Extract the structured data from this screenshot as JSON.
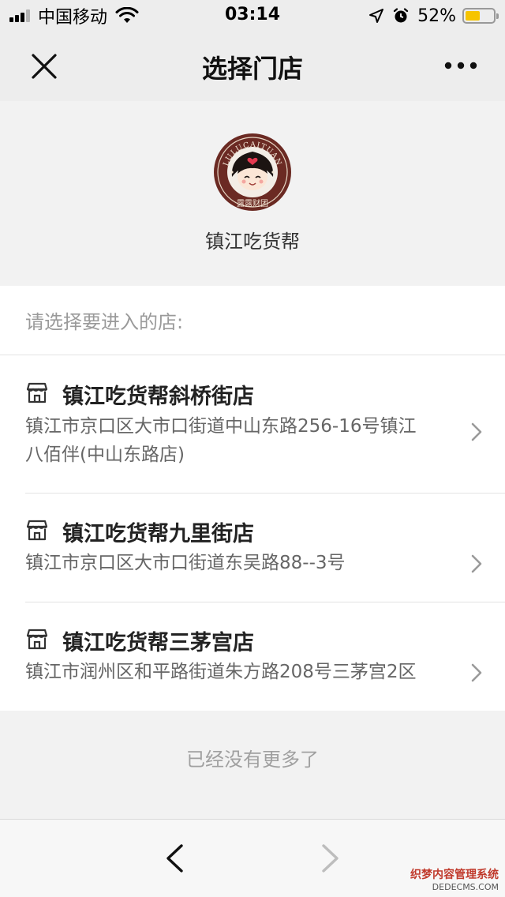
{
  "status_bar": {
    "carrier": "中国移动",
    "time": "03:14",
    "battery_percent": "52%",
    "battery_level": 0.52
  },
  "nav": {
    "title": "选择门店",
    "close_icon": "close-icon",
    "more_icon": "more-icon"
  },
  "brand": {
    "name": "镇江吃货帮",
    "logo_ring_text": "LULUCAITUAN",
    "logo_bottom_text": "露露财团"
  },
  "list": {
    "prompt": "请选择要进入的店:",
    "stores": [
      {
        "name": "镇江吃货帮斜桥街店",
        "address_line1": "镇江市京口区大市口街道中山东路256-16号镇江",
        "address_line2": "八佰伴(中山东路店)"
      },
      {
        "name": "镇江吃货帮九里街店",
        "address_line1": "镇江市京口区大市口街道东吴路88--3号"
      },
      {
        "name": "镇江吃货帮三茅宫店",
        "address_line1": "镇江市润州区和平路街道朱方路208号三茅宫2区"
      }
    ]
  },
  "end_notice": "已经没有更多了",
  "toolbar": {
    "back_icon": "chevron-left-icon",
    "forward_icon": "chevron-right-icon"
  },
  "watermark": {
    "line1": "织梦内容管理系统",
    "line2": "DEDECMS.COM"
  },
  "colors": {
    "nav_background": "#ededed",
    "page_background": "#f2f2f2",
    "battery_fill": "#f6c400",
    "logo_ring": "#6b2a23"
  }
}
